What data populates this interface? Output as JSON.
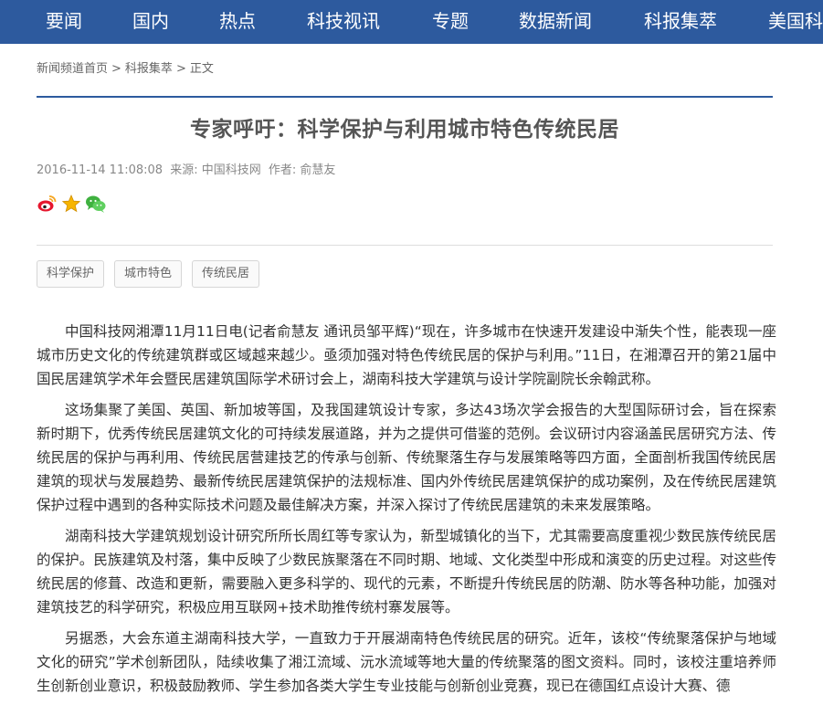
{
  "nav": {
    "items": [
      "要闻",
      "国内",
      "热点",
      "科技视讯",
      "专题",
      "数据新闻",
      "科报集萃",
      "美国科"
    ]
  },
  "breadcrumb": {
    "items": [
      "新闻频道首页",
      "科报集萃",
      "正文"
    ],
    "separator": ">"
  },
  "article": {
    "title": "专家呼吁：科学保护与利用城市特色传统民居",
    "date": "2016-11-14 11:08:08",
    "source": "来源: 中国科技网",
    "author": "作者: 俞慧友",
    "paragraphs": [
      "中国科技网湘潭11月11日电(记者俞慧友 通讯员邹平辉)“现在，许多城市在快速开发建设中渐失个性，能表现一座城市历史文化的传统建筑群或区域越来越少。亟须加强对特色传统民居的保护与利用。”11日，在湘潭召开的第21届中国民居建筑学术年会暨民居建筑国际学术研讨会上，湖南科技大学建筑与设计学院副院长余翰武称。",
      "这场集聚了美国、英国、新加坡等国，及我国建筑设计专家，多达43场次学会报告的大型国际研讨会，旨在探索新时期下，优秀传统民居建筑文化的可持续发展道路，并为之提供可借鉴的范例。会议研讨内容涵盖民居研究方法、传统民居的保护与再利用、传统民居营建技艺的传承与创新、传统聚落生存与发展策略等四方面，全面剖析我国传统民居建筑的现状与发展趋势、最新传统民居建筑保护的法规标准、国内外传统民居建筑保护的成功案例，及在传统民居建筑保护过程中遇到的各种实际技术问题及最佳解决方案，并深入探讨了传统民居建筑的未来发展策略。",
      "湖南科技大学建筑规划设计研究所所长周红等专家认为，新型城镇化的当下，尤其需要高度重视少数民族传统民居的保护。民族建筑及村落，集中反映了少数民族聚落在不同时期、地域、文化类型中形成和演变的历史过程。对这些传统民居的修葺、改造和更新，需要融入更多科学的、现代的元素，不断提升传统民居的防潮、防水等各种功能，加强对建筑技艺的科学研究，积极应用互联网+技术助推传统村寨发展等。",
      "另据悉，大会东道主湖南科技大学，一直致力于开展湖南特色传统民居的研究。近年，该校“传统聚落保护与地域文化的研究”学术创新团队，陆续收集了湘江流域、沅水流域等地大量的传统聚落的图文资料。同时，该校注重培养师生创新创业意识，积极鼓励教师、学生参加各类大学生专业技能与创新创业竞赛，现已在德国红点设计大赛、德"
    ]
  },
  "share": {
    "icons": [
      "weibo-icon",
      "favorite-star-icon",
      "wechat-icon"
    ]
  },
  "tags": [
    "科学保护",
    "城市特色",
    "传统民居"
  ],
  "colors": {
    "nav_bg": "#2d5a9e",
    "nav_text": "#ffffff",
    "title_text": "#555555",
    "body_text": "#333333",
    "meta_text": "#888888"
  }
}
